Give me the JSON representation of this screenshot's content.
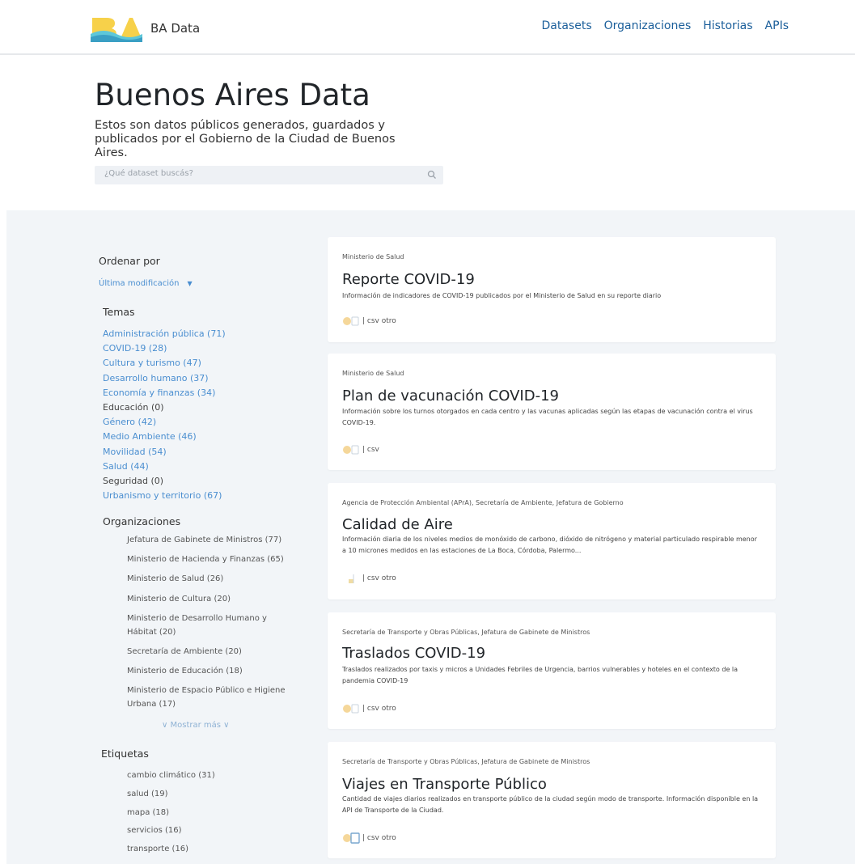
{
  "header": {
    "brand": "BA Data",
    "nav": [
      "Datasets",
      "Organizaciones",
      "Historias",
      "APIs"
    ]
  },
  "hero": {
    "title": "Buenos Aires Data",
    "description": "Estos son datos públicos generados, guardados y publicados por el Gobierno de la Ciudad de Buenos Aires.",
    "search_placeholder": "¿Qué dataset buscás?"
  },
  "sidebar": {
    "sort_heading": "Ordenar por",
    "sort_value": "Última modificación",
    "temas_heading": "Temas",
    "temas": [
      {
        "label": "Administración pública (71)",
        "active": true
      },
      {
        "label": "COVID-19 (28)",
        "active": true
      },
      {
        "label": "Cultura y turismo (47)",
        "active": true
      },
      {
        "label": "Desarrollo humano (37)",
        "active": true
      },
      {
        "label": "Economía y finanzas (34)",
        "active": true
      },
      {
        "label": "Educación (0)",
        "active": false
      },
      {
        "label": "Género (42)",
        "active": true
      },
      {
        "label": "Medio Ambiente (46)",
        "active": true
      },
      {
        "label": "Movilidad (54)",
        "active": true
      },
      {
        "label": "Salud (44)",
        "active": true
      },
      {
        "label": "Seguridad (0)",
        "active": false
      },
      {
        "label": "Urbanismo y territorio (67)",
        "active": true
      }
    ],
    "orgs_heading": "Organizaciones",
    "orgs": [
      "Jefatura de Gabinete de Ministros (77)",
      "Ministerio de Hacienda y Finanzas (65)",
      "Ministerio de Salud (26)",
      "Ministerio de Cultura (20)",
      "Ministerio de Desarrollo Humano y Hábitat (20)",
      "Secretaría de Ambiente (20)",
      "Ministerio de Educación (18)",
      "Ministerio de Espacio Público e Higiene Urbana (17)"
    ],
    "more_label": "∨ Mostrar más ∨",
    "tags_heading": "Etiquetas",
    "tags": [
      "cambio climático (31)",
      "salud (19)",
      "mapa (18)",
      "servicios (16)",
      "transporte (16)"
    ]
  },
  "datasets": [
    {
      "org": "Ministerio de Salud",
      "title": "Reporte COVID-19",
      "description": "Información de indicadores de COVID-19 publicados por el Ministerio de Salud en su reporte diario",
      "formats": "| csv otro"
    },
    {
      "org": "Ministerio de Salud",
      "title": "Plan de vacunación COVID-19",
      "description": "Información sobre los turnos otorgados en cada centro y las vacunas aplicadas según las etapas de vacunación contra el virus COVID-19.",
      "formats": "| csv"
    },
    {
      "org": "Agencia de Protección Ambiental (APrA), Secretaría de Ambiente, Jefatura de Gobierno",
      "title": "Calidad de Aire",
      "description": "Información diaria de los niveles medios de monóxido de carbono, dióxido de nitrógeno y material particulado respirable menor a 10 micrones medidos en las estaciones de La Boca, Córdoba, Palermo...",
      "formats": "| csv otro"
    },
    {
      "org": "Secretaría de Transporte y Obras Públicas, Jefatura de Gabinete de Ministros",
      "title": "Traslados COVID-19",
      "description": "Traslados realizados por taxis y micros a Unidades Febriles de Urgencia, barrios vulnerables y hoteles en el contexto de la pandemia COVID-19",
      "formats": "| csv otro"
    },
    {
      "org": "Secretaría de Transporte y Obras Públicas, Jefatura de Gabinete de Ministros",
      "title": "Viajes en Transporte Público",
      "description": "Cantidad de viajes diarios realizados en transporte público de la ciudad según modo de transporte. Información disponible en la API de Transporte de la Ciudad.",
      "formats": "| csv otro"
    }
  ],
  "colors": {
    "link": "#4a8ed0",
    "nav": "#1a5e9a",
    "content_bg": "#f2f5f8",
    "logo_yellow": "#f7d14a",
    "logo_blue": "#5ec7d9"
  }
}
